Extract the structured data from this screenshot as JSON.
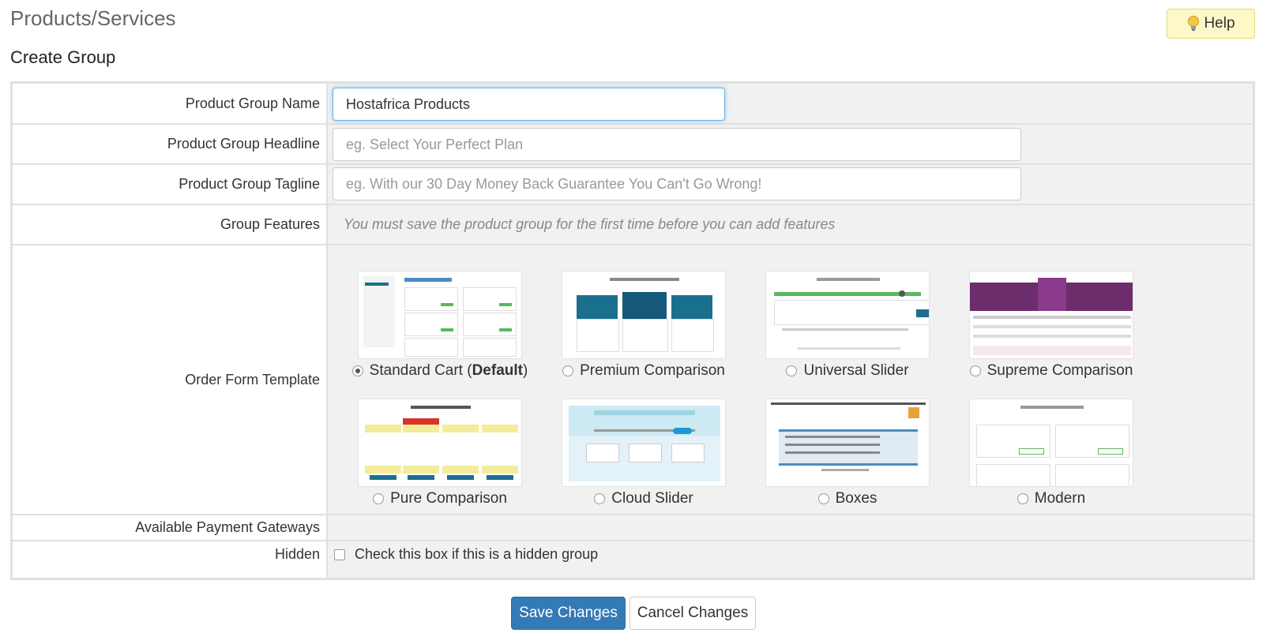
{
  "header": {
    "title": "Products/Services",
    "help_label": "Help",
    "section_title": "Create Group"
  },
  "form": {
    "group_name": {
      "label": "Product Group Name",
      "value": "Hostafrica Products"
    },
    "headline": {
      "label": "Product Group Headline",
      "placeholder": "eg. Select Your Perfect Plan"
    },
    "tagline": {
      "label": "Product Group Tagline",
      "placeholder": "eg. With our 30 Day Money Back Guarantee You Can't Go Wrong!"
    },
    "features": {
      "label": "Group Features",
      "note": "You must save the product group for the first time before you can add features"
    },
    "order_form": {
      "label": "Order Form Template",
      "default_suffix": "Default",
      "templates": [
        {
          "name": "Standard Cart",
          "selected": true,
          "default": true
        },
        {
          "name": "Premium Comparison",
          "selected": false
        },
        {
          "name": "Universal Slider",
          "selected": false
        },
        {
          "name": "Supreme Comparison",
          "selected": false
        },
        {
          "name": "Pure Comparison",
          "selected": false
        },
        {
          "name": "Cloud Slider",
          "selected": false
        },
        {
          "name": "Boxes",
          "selected": false
        },
        {
          "name": "Modern",
          "selected": false
        }
      ]
    },
    "payment_gateways": {
      "label": "Available Payment Gateways"
    },
    "hidden": {
      "label": "Hidden",
      "checkbox_label": "Check this box if this is a hidden group",
      "checked": false
    }
  },
  "actions": {
    "save_label": "Save Changes",
    "cancel_label": "Cancel Changes"
  },
  "colors": {
    "primary": "#337ab7",
    "help_bg": "#fcf8c7",
    "teal": "#1a6f8f",
    "purple": "#6b2d6b"
  }
}
